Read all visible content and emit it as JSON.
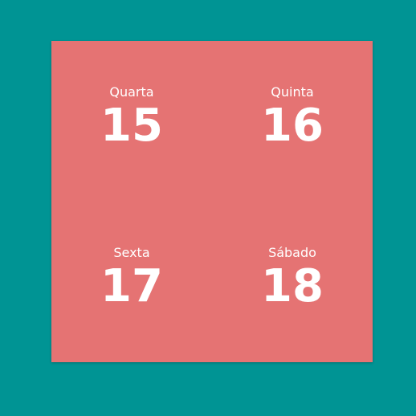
{
  "days": [
    {
      "name": "Quarta",
      "number": "15"
    },
    {
      "name": "Quinta",
      "number": "16"
    },
    {
      "name": "Sexta",
      "number": "17"
    },
    {
      "name": "Sábado",
      "number": "18"
    }
  ],
  "colors": {
    "background": "#009494",
    "card": "#e57373",
    "text": "#ffffff"
  }
}
